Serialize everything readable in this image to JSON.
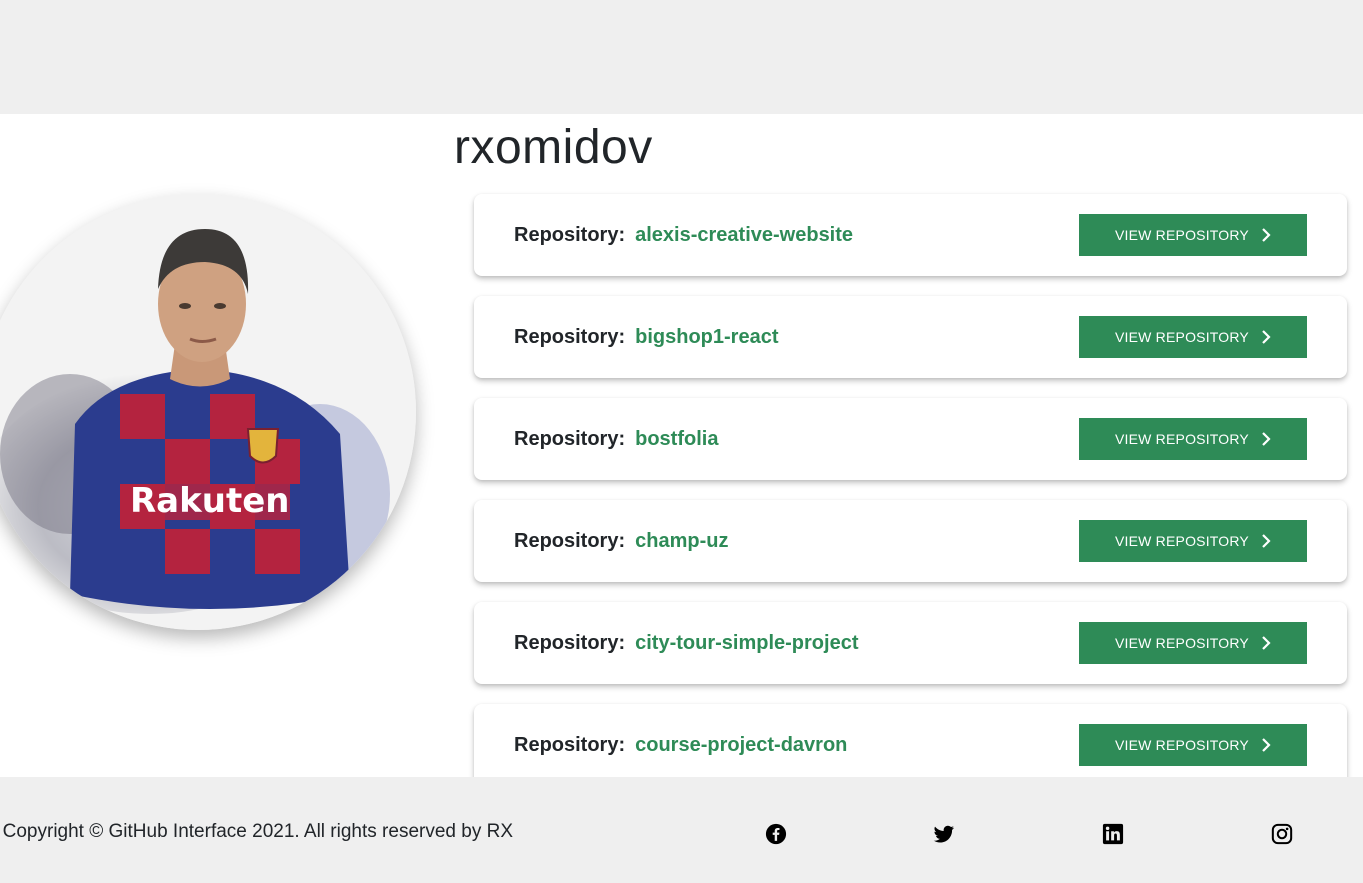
{
  "profile": {
    "username": "rxomidov",
    "avatar_icon": "user-photo"
  },
  "repositories": {
    "label": "Repository:",
    "button_label": "VIEW REPOSITORY",
    "items": [
      {
        "name": "alexis-creative-website"
      },
      {
        "name": "bigshop1-react"
      },
      {
        "name": "bostfolia"
      },
      {
        "name": "champ-uz"
      },
      {
        "name": "city-tour-simple-project"
      },
      {
        "name": "course-project-davron"
      }
    ]
  },
  "footer": {
    "copyright": "Copyright © GitHub Interface 2021. All rights reserved by RX",
    "social": [
      "facebook-icon",
      "twitter-icon",
      "linkedin-icon",
      "instagram-icon"
    ]
  },
  "colors": {
    "accent": "#2e8b57",
    "band": "#efefef",
    "text": "#212529"
  }
}
